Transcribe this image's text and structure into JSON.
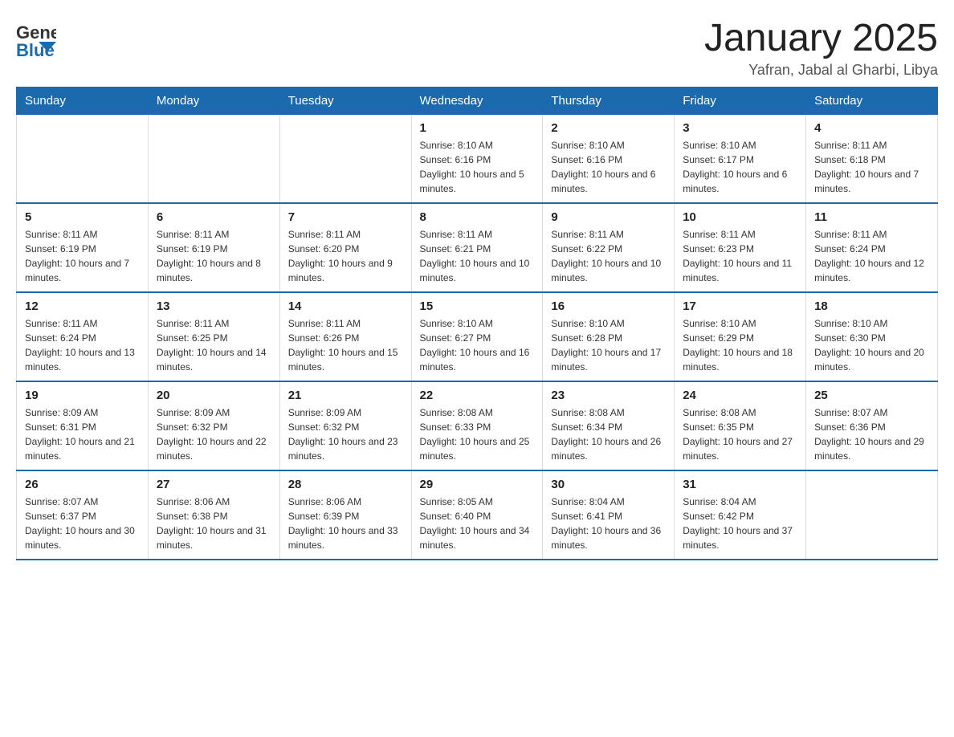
{
  "header": {
    "logo_general": "General",
    "logo_blue": "Blue",
    "title": "January 2025",
    "subtitle": "Yafran, Jabal al Gharbi, Libya"
  },
  "days_of_week": [
    "Sunday",
    "Monday",
    "Tuesday",
    "Wednesday",
    "Thursday",
    "Friday",
    "Saturday"
  ],
  "weeks": [
    [
      {
        "day": "",
        "sunrise": "",
        "sunset": "",
        "daylight": ""
      },
      {
        "day": "",
        "sunrise": "",
        "sunset": "",
        "daylight": ""
      },
      {
        "day": "",
        "sunrise": "",
        "sunset": "",
        "daylight": ""
      },
      {
        "day": "1",
        "sunrise": "Sunrise: 8:10 AM",
        "sunset": "Sunset: 6:16 PM",
        "daylight": "Daylight: 10 hours and 5 minutes."
      },
      {
        "day": "2",
        "sunrise": "Sunrise: 8:10 AM",
        "sunset": "Sunset: 6:16 PM",
        "daylight": "Daylight: 10 hours and 6 minutes."
      },
      {
        "day": "3",
        "sunrise": "Sunrise: 8:10 AM",
        "sunset": "Sunset: 6:17 PM",
        "daylight": "Daylight: 10 hours and 6 minutes."
      },
      {
        "day": "4",
        "sunrise": "Sunrise: 8:11 AM",
        "sunset": "Sunset: 6:18 PM",
        "daylight": "Daylight: 10 hours and 7 minutes."
      }
    ],
    [
      {
        "day": "5",
        "sunrise": "Sunrise: 8:11 AM",
        "sunset": "Sunset: 6:19 PM",
        "daylight": "Daylight: 10 hours and 7 minutes."
      },
      {
        "day": "6",
        "sunrise": "Sunrise: 8:11 AM",
        "sunset": "Sunset: 6:19 PM",
        "daylight": "Daylight: 10 hours and 8 minutes."
      },
      {
        "day": "7",
        "sunrise": "Sunrise: 8:11 AM",
        "sunset": "Sunset: 6:20 PM",
        "daylight": "Daylight: 10 hours and 9 minutes."
      },
      {
        "day": "8",
        "sunrise": "Sunrise: 8:11 AM",
        "sunset": "Sunset: 6:21 PM",
        "daylight": "Daylight: 10 hours and 10 minutes."
      },
      {
        "day": "9",
        "sunrise": "Sunrise: 8:11 AM",
        "sunset": "Sunset: 6:22 PM",
        "daylight": "Daylight: 10 hours and 10 minutes."
      },
      {
        "day": "10",
        "sunrise": "Sunrise: 8:11 AM",
        "sunset": "Sunset: 6:23 PM",
        "daylight": "Daylight: 10 hours and 11 minutes."
      },
      {
        "day": "11",
        "sunrise": "Sunrise: 8:11 AM",
        "sunset": "Sunset: 6:24 PM",
        "daylight": "Daylight: 10 hours and 12 minutes."
      }
    ],
    [
      {
        "day": "12",
        "sunrise": "Sunrise: 8:11 AM",
        "sunset": "Sunset: 6:24 PM",
        "daylight": "Daylight: 10 hours and 13 minutes."
      },
      {
        "day": "13",
        "sunrise": "Sunrise: 8:11 AM",
        "sunset": "Sunset: 6:25 PM",
        "daylight": "Daylight: 10 hours and 14 minutes."
      },
      {
        "day": "14",
        "sunrise": "Sunrise: 8:11 AM",
        "sunset": "Sunset: 6:26 PM",
        "daylight": "Daylight: 10 hours and 15 minutes."
      },
      {
        "day": "15",
        "sunrise": "Sunrise: 8:10 AM",
        "sunset": "Sunset: 6:27 PM",
        "daylight": "Daylight: 10 hours and 16 minutes."
      },
      {
        "day": "16",
        "sunrise": "Sunrise: 8:10 AM",
        "sunset": "Sunset: 6:28 PM",
        "daylight": "Daylight: 10 hours and 17 minutes."
      },
      {
        "day": "17",
        "sunrise": "Sunrise: 8:10 AM",
        "sunset": "Sunset: 6:29 PM",
        "daylight": "Daylight: 10 hours and 18 minutes."
      },
      {
        "day": "18",
        "sunrise": "Sunrise: 8:10 AM",
        "sunset": "Sunset: 6:30 PM",
        "daylight": "Daylight: 10 hours and 20 minutes."
      }
    ],
    [
      {
        "day": "19",
        "sunrise": "Sunrise: 8:09 AM",
        "sunset": "Sunset: 6:31 PM",
        "daylight": "Daylight: 10 hours and 21 minutes."
      },
      {
        "day": "20",
        "sunrise": "Sunrise: 8:09 AM",
        "sunset": "Sunset: 6:32 PM",
        "daylight": "Daylight: 10 hours and 22 minutes."
      },
      {
        "day": "21",
        "sunrise": "Sunrise: 8:09 AM",
        "sunset": "Sunset: 6:32 PM",
        "daylight": "Daylight: 10 hours and 23 minutes."
      },
      {
        "day": "22",
        "sunrise": "Sunrise: 8:08 AM",
        "sunset": "Sunset: 6:33 PM",
        "daylight": "Daylight: 10 hours and 25 minutes."
      },
      {
        "day": "23",
        "sunrise": "Sunrise: 8:08 AM",
        "sunset": "Sunset: 6:34 PM",
        "daylight": "Daylight: 10 hours and 26 minutes."
      },
      {
        "day": "24",
        "sunrise": "Sunrise: 8:08 AM",
        "sunset": "Sunset: 6:35 PM",
        "daylight": "Daylight: 10 hours and 27 minutes."
      },
      {
        "day": "25",
        "sunrise": "Sunrise: 8:07 AM",
        "sunset": "Sunset: 6:36 PM",
        "daylight": "Daylight: 10 hours and 29 minutes."
      }
    ],
    [
      {
        "day": "26",
        "sunrise": "Sunrise: 8:07 AM",
        "sunset": "Sunset: 6:37 PM",
        "daylight": "Daylight: 10 hours and 30 minutes."
      },
      {
        "day": "27",
        "sunrise": "Sunrise: 8:06 AM",
        "sunset": "Sunset: 6:38 PM",
        "daylight": "Daylight: 10 hours and 31 minutes."
      },
      {
        "day": "28",
        "sunrise": "Sunrise: 8:06 AM",
        "sunset": "Sunset: 6:39 PM",
        "daylight": "Daylight: 10 hours and 33 minutes."
      },
      {
        "day": "29",
        "sunrise": "Sunrise: 8:05 AM",
        "sunset": "Sunset: 6:40 PM",
        "daylight": "Daylight: 10 hours and 34 minutes."
      },
      {
        "day": "30",
        "sunrise": "Sunrise: 8:04 AM",
        "sunset": "Sunset: 6:41 PM",
        "daylight": "Daylight: 10 hours and 36 minutes."
      },
      {
        "day": "31",
        "sunrise": "Sunrise: 8:04 AM",
        "sunset": "Sunset: 6:42 PM",
        "daylight": "Daylight: 10 hours and 37 minutes."
      },
      {
        "day": "",
        "sunrise": "",
        "sunset": "",
        "daylight": ""
      }
    ]
  ]
}
